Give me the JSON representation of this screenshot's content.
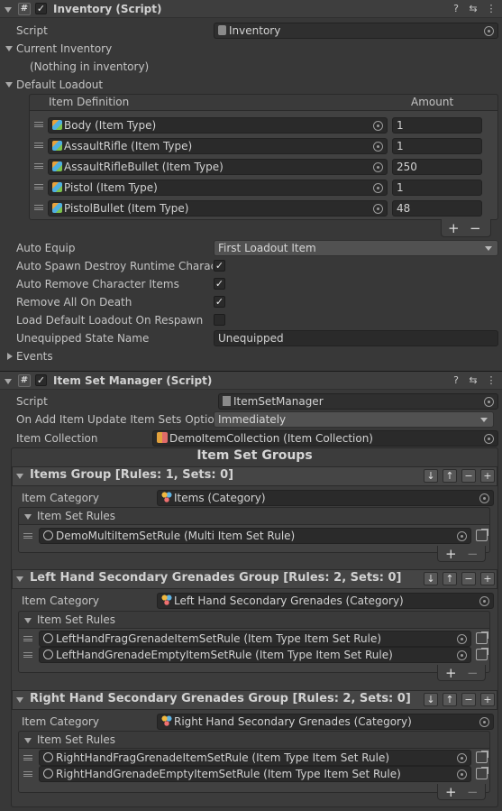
{
  "inventory": {
    "title": "Inventory (Script)",
    "enabled": true,
    "script_label": "Script",
    "script_value": "Inventory",
    "current_inventory_label": "Current Inventory",
    "current_inventory_empty": "(Nothing in inventory)",
    "default_loadout_label": "Default Loadout",
    "col_item_definition": "Item Definition",
    "col_amount": "Amount",
    "loadout": [
      {
        "item": "Body (Item Type)",
        "amount": "1"
      },
      {
        "item": "AssaultRifle (Item Type)",
        "amount": "1"
      },
      {
        "item": "AssaultRifleBullet (Item Type)",
        "amount": "250"
      },
      {
        "item": "Pistol (Item Type)",
        "amount": "1"
      },
      {
        "item": "PistolBullet (Item Type)",
        "amount": "48"
      }
    ],
    "auto_equip_label": "Auto Equip",
    "auto_equip_value": "First Loadout Item",
    "auto_spawn_label": "Auto Spawn Destroy Runtime Character",
    "auto_spawn_value": true,
    "auto_remove_label": "Auto Remove Character Items",
    "auto_remove_value": true,
    "remove_all_label": "Remove All On Death",
    "remove_all_value": true,
    "load_default_label": "Load Default Loadout On Respawn",
    "load_default_value": false,
    "unequipped_label": "Unequipped State Name",
    "unequipped_value": "Unequipped",
    "events_label": "Events"
  },
  "item_set_manager": {
    "title": "Item Set Manager (Script)",
    "enabled": true,
    "script_label": "Script",
    "script_value": "ItemSetManager",
    "on_add_label": "On Add Item Update Item Sets Option",
    "on_add_value": "Immediately",
    "item_collection_label": "Item Collection",
    "item_collection_value": "DemoItemCollection (Item Collection)",
    "groups_heading": "Item Set Groups",
    "item_category_label": "Item Category",
    "item_set_rules_label": "Item Set Rules",
    "groups": [
      {
        "title": "Items Group [Rules: 1, Sets: 0]",
        "category": "Items (Category)",
        "rules": [
          "DemoMultiItemSetRule (Multi Item Set Rule)"
        ]
      },
      {
        "title": "Left Hand Secondary Grenades Group [Rules: 2, Sets: 0]",
        "category": "Left Hand Secondary Grenades (Category)",
        "rules": [
          "LeftHandFragGrenadeItemSetRule (Item Type Item Set Rule)",
          "LeftHandGrenadeEmptyItemSetRule (Item Type Item Set Rule)"
        ]
      },
      {
        "title": "Right Hand Secondary Grenades Group [Rules: 2, Sets: 0]",
        "category": "Right Hand Secondary Grenades (Category)",
        "rules": [
          "RightHandFragGrenadeItemSetRule (Item Type Item Set Rule)",
          "RightHandGrenadeEmptyItemSetRule (Item Type Item Set Rule)"
        ]
      }
    ]
  },
  "icons": {
    "help": "help-icon",
    "presets": "presets-icon",
    "menu": "kebab-menu-icon",
    "check": "✓",
    "plus": "+",
    "minus": "−",
    "down": "↓",
    "up": "↑"
  },
  "colors": {
    "background": "#383838",
    "field": "#2a2a2a",
    "header": "#3e3e3e"
  }
}
